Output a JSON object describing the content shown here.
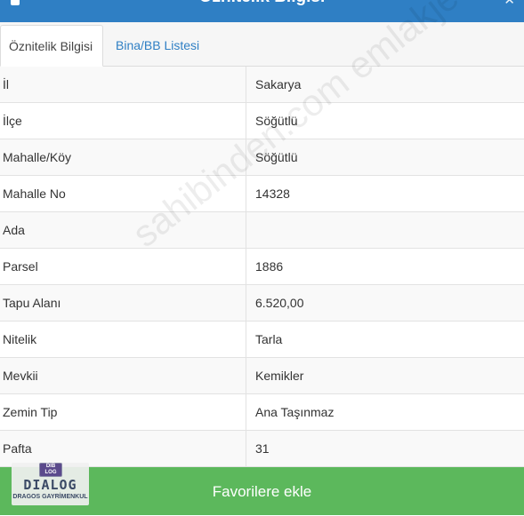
{
  "header": {
    "title": "Öznitelik Bilgisi"
  },
  "tabs": [
    {
      "label": "Öznitelik Bilgisi",
      "active": true
    },
    {
      "label": "Bina/BB Listesi",
      "active": false
    }
  ],
  "rows": [
    {
      "label": "İl",
      "value": "Sakarya"
    },
    {
      "label": "İlçe",
      "value": "Söğütlü"
    },
    {
      "label": "Mahalle/Köy",
      "value": "Söğütlü"
    },
    {
      "label": "Mahalle No",
      "value": "14328"
    },
    {
      "label": "Ada",
      "value": ""
    },
    {
      "label": "Parsel",
      "value": "1886"
    },
    {
      "label": "Tapu Alanı",
      "value": "6.520,00"
    },
    {
      "label": "Nitelik",
      "value": "Tarla"
    },
    {
      "label": "Mevkii",
      "value": "Kemikler"
    },
    {
      "label": "Zemin Tip",
      "value": "Ana Taşınmaz"
    },
    {
      "label": "Pafta",
      "value": "31"
    }
  ],
  "watermark": "sahibinden.com emlakjet.com",
  "favorite_button": {
    "label": "Favorilere ekle"
  },
  "logo": {
    "badge": "DIB LOG",
    "name": "DIALOG",
    "subtitle": "DRAGOS GAYRİMENKUL"
  },
  "colors": {
    "header": "#2f7fc4",
    "tab_link": "#2f7fc4",
    "button": "#5cb85c"
  }
}
